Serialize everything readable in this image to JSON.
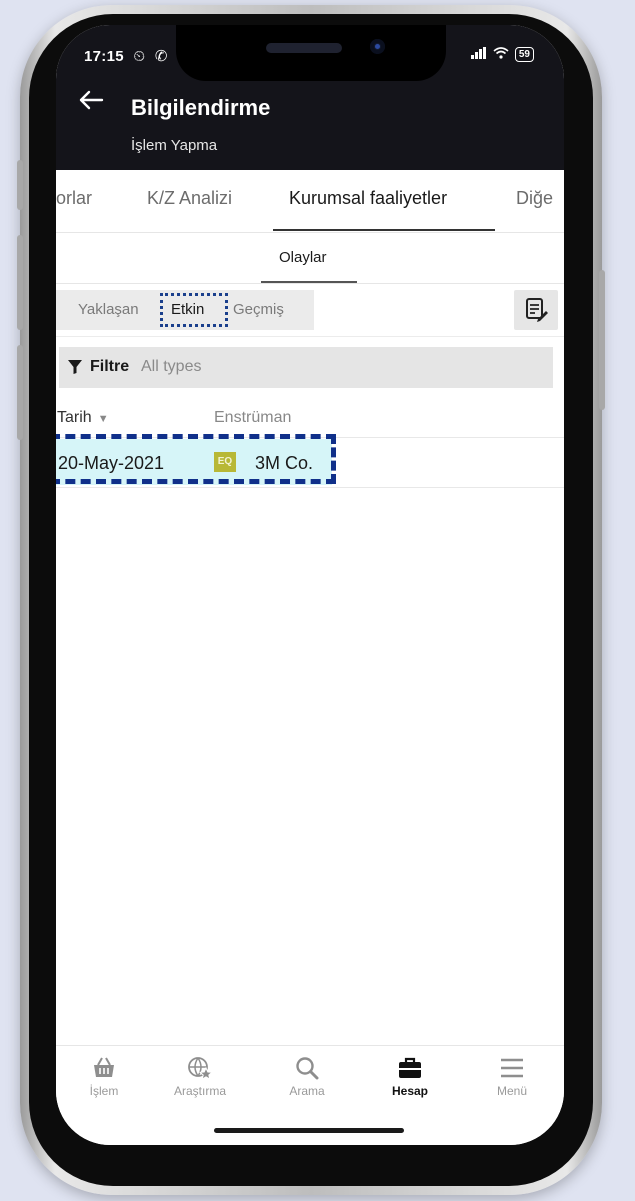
{
  "status_bar": {
    "time": "17:15",
    "battery": "59"
  },
  "app_bar": {
    "title": "Bilgilendirme",
    "subtitle": "İşlem Yapma"
  },
  "tabs": [
    {
      "label": "orlar"
    },
    {
      "label": "K/Z Analizi"
    },
    {
      "label": "Kurumsal faaliyetler",
      "active": true
    },
    {
      "label": "Diğe"
    }
  ],
  "subtab": {
    "label": "Olaylar"
  },
  "segments": [
    {
      "label": "Yaklaşan"
    },
    {
      "label": "Etkin",
      "active": true
    },
    {
      "label": "Geçmiş"
    }
  ],
  "filter": {
    "label": "Filtre",
    "value": "All types"
  },
  "table": {
    "headers": {
      "date": "Tarih",
      "sort_icon": "▼",
      "instrument": "Enstrüman"
    },
    "rows": [
      {
        "date": "20-May-2021",
        "badge": "EQ",
        "instrument": "3M Co."
      }
    ]
  },
  "bottom_nav": [
    {
      "label": "İşlem",
      "icon": "basket-icon"
    },
    {
      "label": "Araştırma",
      "icon": "globe-star-icon"
    },
    {
      "label": "Arama",
      "icon": "search-icon"
    },
    {
      "label": "Hesap",
      "icon": "briefcase-icon",
      "active": true
    },
    {
      "label": "Menü",
      "icon": "menu-icon"
    }
  ],
  "colors": {
    "app_bar_bg": "#14141a",
    "row_highlight": "#d6f5f8",
    "annotation_border": "#10308a",
    "eq_badge": "#b8b836"
  }
}
